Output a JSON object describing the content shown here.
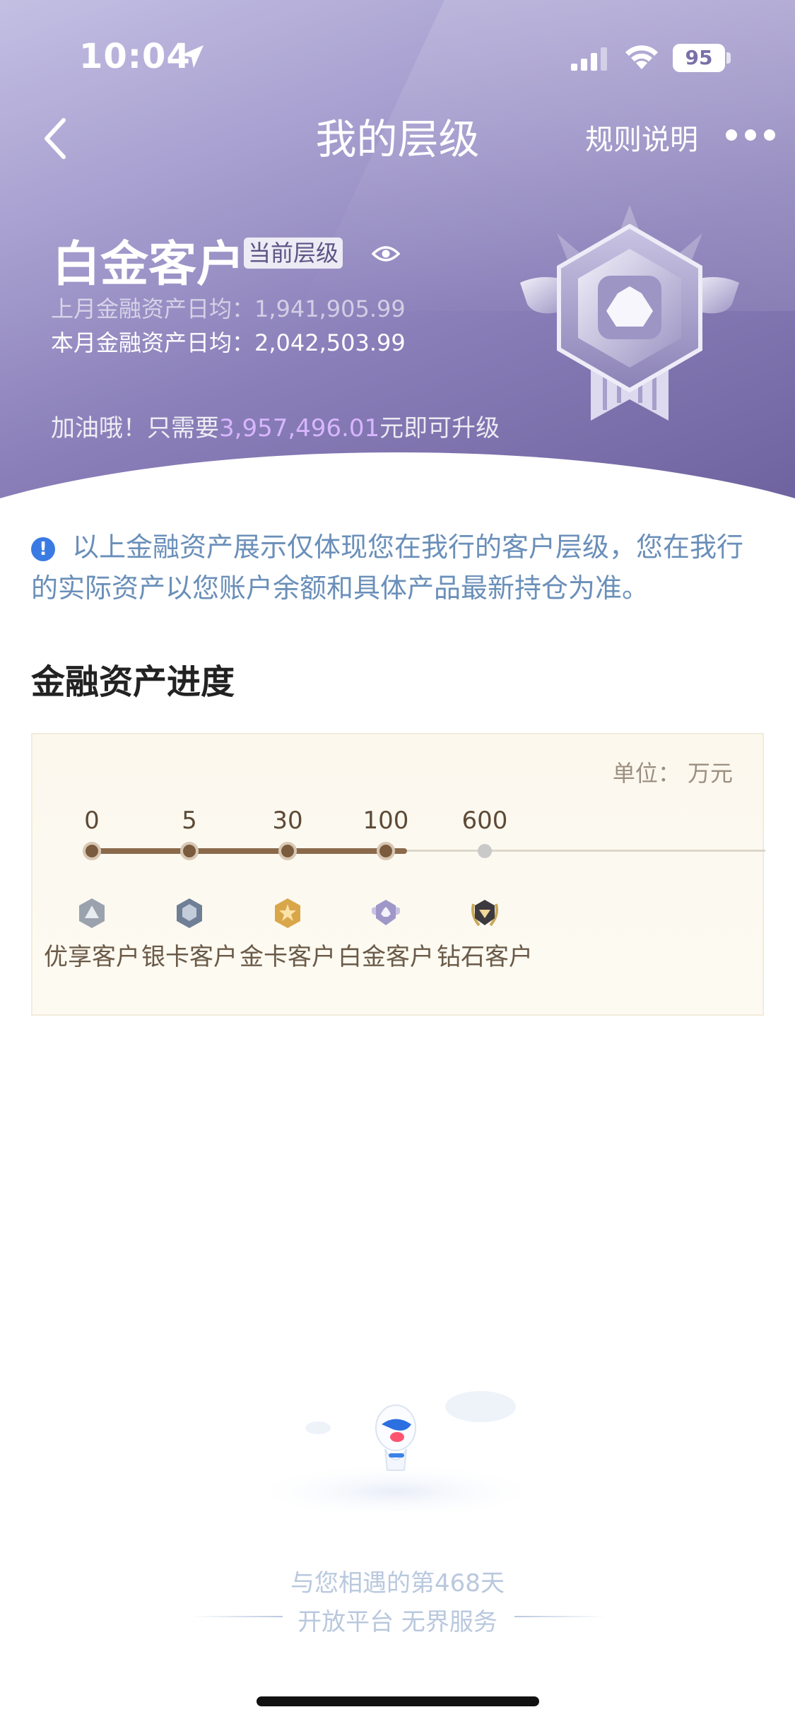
{
  "status_bar": {
    "time": "10:04",
    "battery": "95"
  },
  "nav": {
    "title": "我的层级",
    "rules_link": "规则说明"
  },
  "tier": {
    "name": "白金客户",
    "badge": "当前层级",
    "last_month_label": "上月金融资产日均：",
    "last_month_value": "1,941,905.99",
    "this_month_label": "本月金融资产日均：",
    "this_month_value": "2,042,503.99",
    "upgrade_prefix": "加油哦！只需要",
    "upgrade_amount": "3,957,496.01",
    "upgrade_suffix": "元即可升级"
  },
  "notice": {
    "text": "以上金融资产展示仅体现您在我行的客户层级，您在我行的实际资产以您账户余额和具体产品最新持仓为准。"
  },
  "progress": {
    "section_title": "金融资产进度",
    "unit_label": "单位：  万元",
    "levels": [
      {
        "value": "0",
        "name": "优享客户",
        "reached": true,
        "icon": "silver-triangle-badge-icon"
      },
      {
        "value": "5",
        "name": "银卡客户",
        "reached": true,
        "icon": "silver-shield-badge-icon"
      },
      {
        "value": "30",
        "name": "金卡客户",
        "reached": true,
        "icon": "gold-star-badge-icon"
      },
      {
        "value": "100",
        "name": "白金客户",
        "reached": true,
        "icon": "platinum-winged-badge-icon"
      },
      {
        "value": "600",
        "name": "钻石客户",
        "reached": false,
        "icon": "diamond-laurel-badge-icon"
      }
    ],
    "colors": {
      "reached": "#7b5b3d",
      "unreached": "#c9c9c9"
    }
  },
  "footer": {
    "days_text": "与您相遇的第468天",
    "slogan": "开放平台 无界服务"
  },
  "theme": {
    "header_gradient_start": "#c3bfe3",
    "header_gradient_end": "#6f639f",
    "upgrade_amount_color": "#d8b6ff",
    "notice_color": "#6a8fb9"
  }
}
